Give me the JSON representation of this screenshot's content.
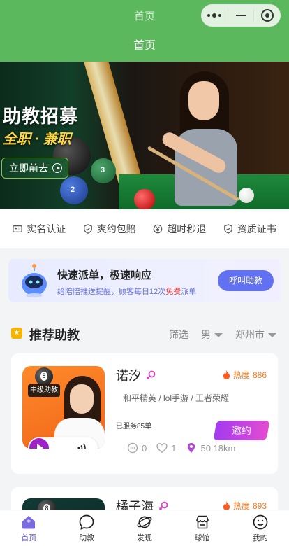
{
  "top_bar": {
    "ghost_title": "首页"
  },
  "nav": {
    "title": "首页"
  },
  "banner": {
    "headline": "助教招募",
    "subline": "全职 · 兼职",
    "cta": "立即前去",
    "ball_labels": [
      "2",
      "3"
    ]
  },
  "features": [
    {
      "icon": "id-card-icon",
      "label": "实名认证"
    },
    {
      "icon": "shield-check-icon",
      "label": "爽约包赔"
    },
    {
      "icon": "yen-coin-icon",
      "label": "超时秒退"
    },
    {
      "icon": "shield-icon",
      "label": "资质证书"
    }
  ],
  "dispatch": {
    "title": "快速派单，极速响应",
    "desc_prefix": "给陪陪推送提醒，顾客每日12次",
    "desc_highlight": "免费",
    "desc_suffix": "派单",
    "button": "呼叫助教"
  },
  "section": {
    "title": "推荐助教",
    "filter_label": "筛选",
    "gender": "男",
    "city": "郑州市"
  },
  "coaches": [
    {
      "name": "诺汐",
      "level": "中级助教",
      "heat_label": "热度",
      "heat_value": "886",
      "games": "和平精英 / lol手游 / 王者荣耀",
      "served": "已服务85单",
      "invite": "邀约",
      "comments": "0",
      "likes": "1",
      "distance": "50.18km"
    },
    {
      "name": "橘子海",
      "heat_label": "热度",
      "heat_value": "893"
    }
  ],
  "tabs": [
    {
      "label": "首页",
      "icon": "home-icon",
      "active": true
    },
    {
      "label": "助教",
      "icon": "chat-bubble-icon",
      "active": false
    },
    {
      "label": "发现",
      "icon": "planet-icon",
      "active": false
    },
    {
      "label": "球馆",
      "icon": "store-icon",
      "active": false
    },
    {
      "label": "我的",
      "icon": "smile-face-icon",
      "active": false
    }
  ],
  "colors": {
    "nav_green": "#5cb85c",
    "accent_purple": "#6a5bd8",
    "call_button": "#6271f1",
    "heat_orange": "#ff7a1a",
    "free_red": "#e53935"
  }
}
